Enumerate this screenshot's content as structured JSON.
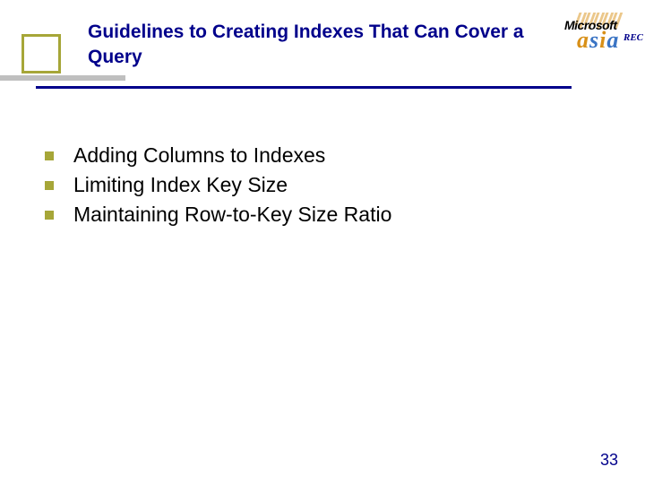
{
  "title": "Guidelines to Creating Indexes That Can Cover a Query",
  "logo": {
    "brand": "Microsoft",
    "sub": "asia",
    "tag": "REC"
  },
  "bullets": [
    "Adding Columns to Indexes",
    "Limiting Index Key Size",
    "Maintaining Row-to-Key Size Ratio"
  ],
  "page_number": "33",
  "colors": {
    "navy": "#00008B",
    "olive": "#a6a638",
    "grey": "#bfbfbf"
  }
}
